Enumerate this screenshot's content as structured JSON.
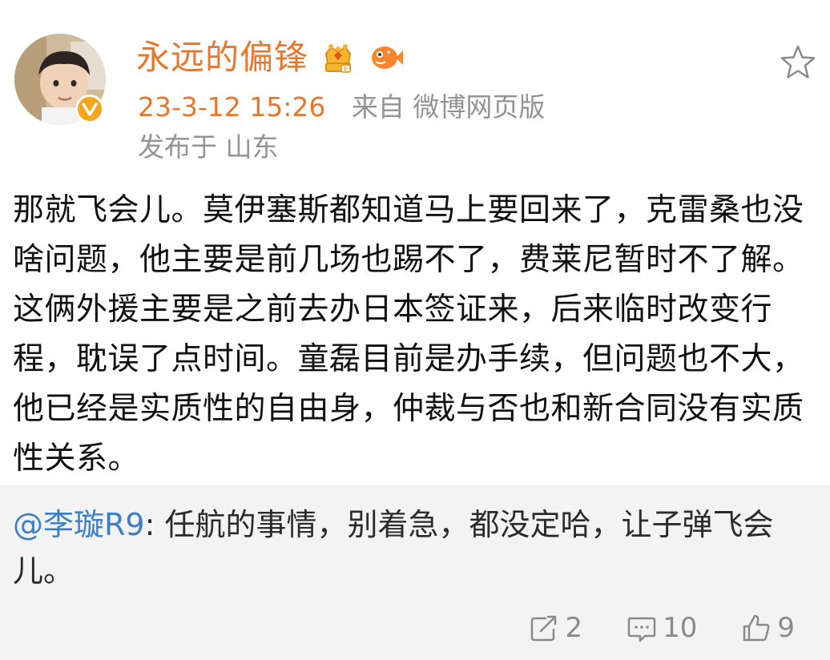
{
  "post": {
    "author": {
      "name": "永远的偏锋"
    },
    "time": "23-3-12 15:26",
    "source": "来自 微博网页版",
    "location": "发布于 山东",
    "content": "那就飞会儿。莫伊塞斯都知道马上要回来了，克雷桑也没啥问题，他主要是前几场也踢不了，费莱尼暂时不了解。这俩外援主要是之前去办日本签证来，后来临时改变行程，耽误了点时间。童磊目前是办手续，但问题也不大，他已经是实质性的自由身，仲裁与否也和新合同没有实质性关系。"
  },
  "repost": {
    "mention": "@李璇R9",
    "text": ": 任航的事情，别着急，都没定哈，让子弹飞会儿。"
  },
  "actions": {
    "repost_count": "2",
    "comment_count": "10",
    "like_count": "9"
  },
  "icons": {
    "star": "star-icon",
    "repost": "repost-icon",
    "comment": "comment-icon",
    "like": "like-icon"
  },
  "colors": {
    "username": "#e8772e",
    "mention": "#3b7fc4",
    "meta": "#939393",
    "repost_bg": "#f3f3f3"
  }
}
